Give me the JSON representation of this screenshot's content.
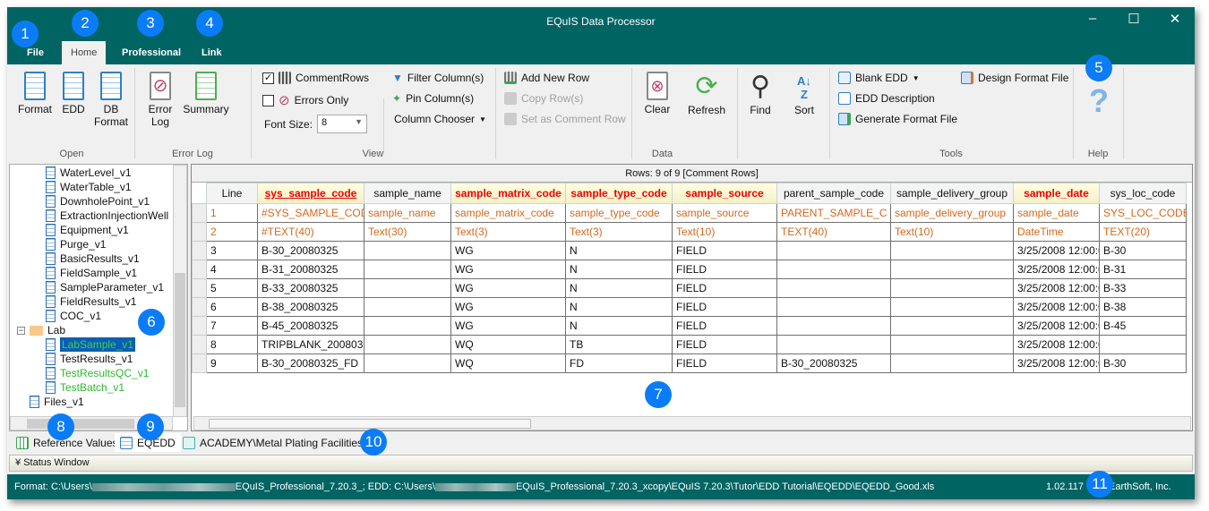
{
  "window": {
    "title": "EQuIS Data Processor",
    "minimize": "–",
    "maximize": "☐",
    "close": "✕"
  },
  "ribbon_tabs": [
    {
      "label": "File"
    },
    {
      "label": "Home",
      "active": true
    },
    {
      "label": "Professional"
    },
    {
      "label": "Link"
    }
  ],
  "groups": {
    "open": {
      "label": "Open",
      "buttons": [
        "Format",
        "EDD",
        "DB Format"
      ]
    },
    "error_log": {
      "label": "Error Log",
      "buttons": [
        "Error Log",
        "Summary"
      ]
    },
    "view": {
      "label": "View",
      "comment_rows": "CommentRows",
      "comment_rows_checked": true,
      "errors_only": "Errors Only",
      "errors_only_checked": false,
      "font_size_label": "Font Size:",
      "font_size_value": "8",
      "filter": "Filter Column(s)",
      "pin": "Pin Column(s)",
      "chooser": "Column Chooser"
    },
    "data": {
      "label": "Data",
      "add_row": "Add New Row",
      "copy_row": "Copy Row(s)",
      "set_comment": "Set as Comment Row",
      "clear": "Clear",
      "refresh": "Refresh",
      "find": "Find",
      "sort": "Sort"
    },
    "tools": {
      "label": "Tools",
      "blank_edd": "Blank EDD",
      "edd_description": "EDD Description",
      "generate": "Generate Format File",
      "design": "Design Format File"
    },
    "help": {
      "label": "Help",
      "icon": "?"
    }
  },
  "tree": {
    "items": [
      {
        "label": "WaterLevel_v1"
      },
      {
        "label": "WaterTable_v1"
      },
      {
        "label": "DownholePoint_v1"
      },
      {
        "label": "ExtractionInjectionWell"
      },
      {
        "label": "Equipment_v1"
      },
      {
        "label": "Purge_v1"
      },
      {
        "label": "BasicResults_v1"
      },
      {
        "label": "FieldSample_v1"
      },
      {
        "label": "SampleParameter_v1"
      },
      {
        "label": "FieldResults_v1"
      },
      {
        "label": "COC_v1"
      }
    ],
    "lab_folder": "Lab",
    "lab_items": [
      {
        "label": "LabSample_v1",
        "state": "selected"
      },
      {
        "label": "TestResults_v1",
        "state": "normal"
      },
      {
        "label": "TestResultsQC_v1",
        "state": "green"
      },
      {
        "label": "TestBatch_v1",
        "state": "green"
      }
    ],
    "files": "Files_v1"
  },
  "grid": {
    "rows_info": "Rows: 9 of 9  [Comment Rows]",
    "columns": [
      {
        "name": "Line",
        "req": false
      },
      {
        "name": "sys_sample_code",
        "req": true
      },
      {
        "name": "sample_name",
        "req": false
      },
      {
        "name": "sample_matrix_code",
        "req": true
      },
      {
        "name": "sample_type_code",
        "req": true
      },
      {
        "name": "sample_source",
        "req": true
      },
      {
        "name": "parent_sample_code",
        "req": false
      },
      {
        "name": "sample_delivery_group",
        "req": false
      },
      {
        "name": "sample_date",
        "req": true
      },
      {
        "name": "sys_loc_code",
        "req": false
      }
    ],
    "rows": [
      {
        "comment": true,
        "cells": [
          "1",
          "#SYS_SAMPLE_COD",
          "sample_name",
          "sample_matrix_code",
          "sample_type_code",
          "sample_source",
          "PARENT_SAMPLE_C",
          "sample_delivery_group",
          "sample_date",
          "SYS_LOC_CODE"
        ]
      },
      {
        "comment": true,
        "cells": [
          "2",
          "#TEXT(40)",
          "Text(30)",
          "Text(3)",
          "Text(3)",
          "Text(10)",
          "TEXT(40)",
          "Text(10)",
          "DateTime",
          "TEXT(20)"
        ]
      },
      {
        "comment": false,
        "cells": [
          "3",
          "B-30_20080325",
          "",
          "WG",
          "N",
          "FIELD",
          "",
          "",
          "3/25/2008 12:00:0",
          "B-30"
        ]
      },
      {
        "comment": false,
        "cells": [
          "4",
          "B-31_20080325",
          "",
          "WG",
          "N",
          "FIELD",
          "",
          "",
          "3/25/2008 12:00:0",
          "B-31"
        ]
      },
      {
        "comment": false,
        "cells": [
          "5",
          "B-33_20080325",
          "",
          "WG",
          "N",
          "FIELD",
          "",
          "",
          "3/25/2008 12:00:0",
          "B-33"
        ]
      },
      {
        "comment": false,
        "cells": [
          "6",
          "B-38_20080325",
          "",
          "WG",
          "N",
          "FIELD",
          "",
          "",
          "3/25/2008 12:00:0",
          "B-38"
        ]
      },
      {
        "comment": false,
        "cells": [
          "7",
          "B-45_20080325",
          "",
          "WG",
          "N",
          "FIELD",
          "",
          "",
          "3/25/2008 12:00:0",
          "B-45"
        ]
      },
      {
        "comment": false,
        "cells": [
          "8",
          "TRIPBLANK_2008032",
          "",
          "WQ",
          "TB",
          "FIELD",
          "",
          "",
          "3/25/2008 12:00:0",
          ""
        ]
      },
      {
        "comment": false,
        "cells": [
          "9",
          "B-30_20080325_FD",
          "",
          "WQ",
          "FD",
          "FIELD",
          "B-30_20080325",
          "",
          "3/25/2008 12:00:0",
          "B-30"
        ]
      }
    ]
  },
  "bottom_tabs": [
    {
      "label": "Reference Values",
      "icon": "grid-icon"
    },
    {
      "label": "EQEDD",
      "icon": "table-icon",
      "active": true
    },
    {
      "label": "ACADEMY\\Metal Plating Facilities",
      "icon": "cube-icon"
    }
  ],
  "status_window": "Status Window",
  "statusbar": {
    "format_prefix": "Format: C:\\Users\\",
    "format_suffix": "EQuIS_Professional_7.20.3_; EDD: C:\\Users\\",
    "edd_suffix": "EQuIS_Professional_7.20.3_xcopy\\EQuIS 7.20.3\\Tutor\\EDD Tutorial\\EQEDD\\EQEDD_Good.xls",
    "version": "1.02.117",
    "company": "EarthSoft, Inc."
  },
  "callouts": [
    "1",
    "2",
    "3",
    "4",
    "5",
    "6",
    "7",
    "8",
    "9",
    "10",
    "11"
  ],
  "colors": {
    "titlebar": "#006463",
    "required_header": "#ee0000",
    "comment_text": "#d2691e",
    "callout": "#0b7cf7"
  }
}
